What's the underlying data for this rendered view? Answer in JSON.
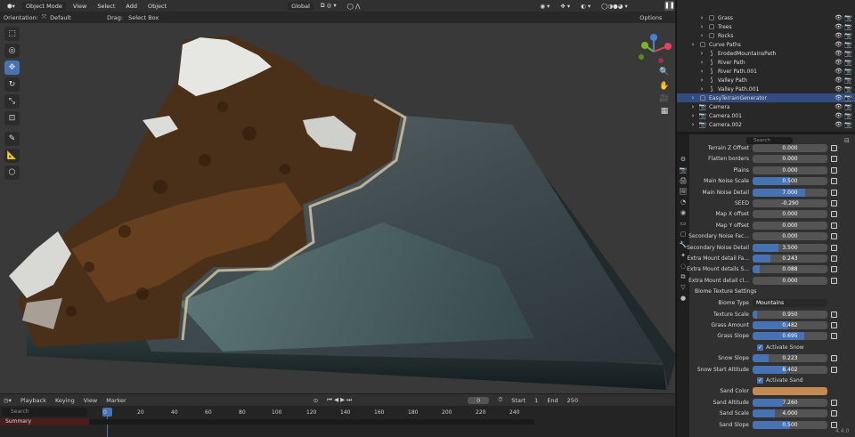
{
  "topbar": {
    "mode": "Object Mode",
    "menus": [
      "View",
      "Select",
      "Add",
      "Object"
    ],
    "transform": "Global",
    "options": "Options"
  },
  "toolsettings": {
    "orientation_label": "Orientation:",
    "orientation": "Default",
    "drag_label": "Drag:",
    "drag": "Select Box"
  },
  "outliner": [
    {
      "name": "Grass",
      "indent": 2
    },
    {
      "name": "Trees",
      "indent": 2
    },
    {
      "name": "Rocks",
      "indent": 2
    },
    {
      "name": "Curve Paths",
      "indent": 1
    },
    {
      "name": "ErodedMountainsPath",
      "indent": 2
    },
    {
      "name": "River Path",
      "indent": 2
    },
    {
      "name": "River Path.001",
      "indent": 2
    },
    {
      "name": "Valley Path",
      "indent": 2
    },
    {
      "name": "Valley Path.001",
      "indent": 2
    },
    {
      "name": "EasyTerrainGenerator",
      "indent": 1,
      "selected": true
    },
    {
      "name": "Camera",
      "indent": 1
    },
    {
      "name": "Camera.001",
      "indent": 1
    },
    {
      "name": "Camera.002",
      "indent": 1
    }
  ],
  "properties": {
    "search_placeholder": "Search",
    "cut_row": {
      "label": "Terrain Z Offset",
      "value": "0.000"
    },
    "rows": [
      {
        "label": "Flatten borders",
        "value": "0.000",
        "fill": 0
      },
      {
        "label": "Plains",
        "value": "0.000",
        "fill": 0
      },
      {
        "label": "Main Noise Scale",
        "value": "0.500",
        "fill": 0.5
      },
      {
        "label": "Main Noise Detail",
        "value": "7.000",
        "fill": 0.7
      },
      {
        "label": "SEED",
        "value": "-0.290",
        "fill": 0,
        "arrows": true
      },
      {
        "label": "Map X offset",
        "value": "0.000",
        "fill": 0
      },
      {
        "label": "Map Y offset",
        "value": "0.000",
        "fill": 0
      },
      {
        "label": "Secondary Noise Fac...",
        "value": "0.000",
        "fill": 0
      },
      {
        "label": "Secondary Noise Detail",
        "value": "3.500",
        "fill": 0.35
      },
      {
        "label": "Extra Mount detail Fa...",
        "value": "0.243",
        "fill": 0.24
      },
      {
        "label": "Extra Mount details S...",
        "value": "0.088",
        "fill": 0.09
      },
      {
        "label": "Extra Mount detail cl...",
        "value": "0.000",
        "fill": 0
      }
    ],
    "panel_title": "Biome Texture Settings",
    "biome_label": "Biome Type",
    "biome_value": "Mountains",
    "rows2": [
      {
        "label": "Texture Scale",
        "value": "0.950",
        "fill": 0.06
      },
      {
        "label": "Grass Amount",
        "value": "0.482",
        "fill": 0.48
      },
      {
        "label": "Grass Slope",
        "value": "0.695",
        "fill": 0.69
      }
    ],
    "check1": "Activate Snow",
    "rows3": [
      {
        "label": "Snow Slope",
        "value": "0.223",
        "fill": 0.22
      },
      {
        "label": "Snow Start Altitude",
        "value": "8.402",
        "fill": 0.45
      }
    ],
    "check2": "Activate Sand",
    "sand_color_label": "Sand Color",
    "sand_color": "#c48a52",
    "rows4": [
      {
        "label": "Sand Altitude",
        "value": "7.260",
        "fill": 0.4
      },
      {
        "label": "Sand Scale",
        "value": "4.000",
        "fill": 0.3
      },
      {
        "label": "Sand Slope",
        "value": "0.500",
        "fill": 0.5
      }
    ]
  },
  "timeline": {
    "menus": [
      "Playback",
      "Keying",
      "View",
      "Marker"
    ],
    "current": "0",
    "start_label": "Start",
    "start": "1",
    "end_label": "End",
    "end": "250",
    "frames": [
      "0",
      "20",
      "40",
      "60",
      "80",
      "100",
      "120",
      "140",
      "160",
      "180",
      "200",
      "220",
      "240"
    ],
    "search_placeholder": "Search",
    "summary": "Summary"
  },
  "version": "4.4.0"
}
